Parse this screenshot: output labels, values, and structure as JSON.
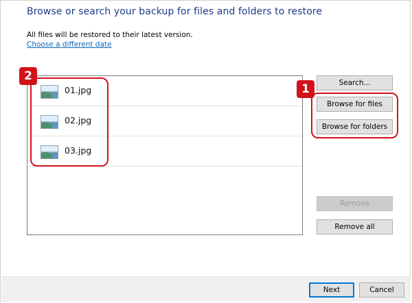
{
  "heading": "Browse or search your backup for files and folders to restore",
  "info_text": "All files will be restored to their latest version.",
  "choose_date_link": "Choose a different date",
  "files": [
    {
      "name": "01.jpg",
      "icon": "image-file-icon"
    },
    {
      "name": "02.jpg",
      "icon": "image-file-icon"
    },
    {
      "name": "03.jpg",
      "icon": "image-file-icon"
    }
  ],
  "buttons": {
    "search": "Search...",
    "browse_files": "Browse for files",
    "browse_folders": "Browse for folders",
    "remove": "Remove",
    "remove_all": "Remove all",
    "next": "Next",
    "cancel": "Cancel"
  },
  "badges": {
    "files_badge": "2",
    "buttons_badge": "1"
  },
  "colors": {
    "callout_red": "#d0121b",
    "heading_blue": "#1e3a8a",
    "link_blue": "#0a66b5"
  }
}
